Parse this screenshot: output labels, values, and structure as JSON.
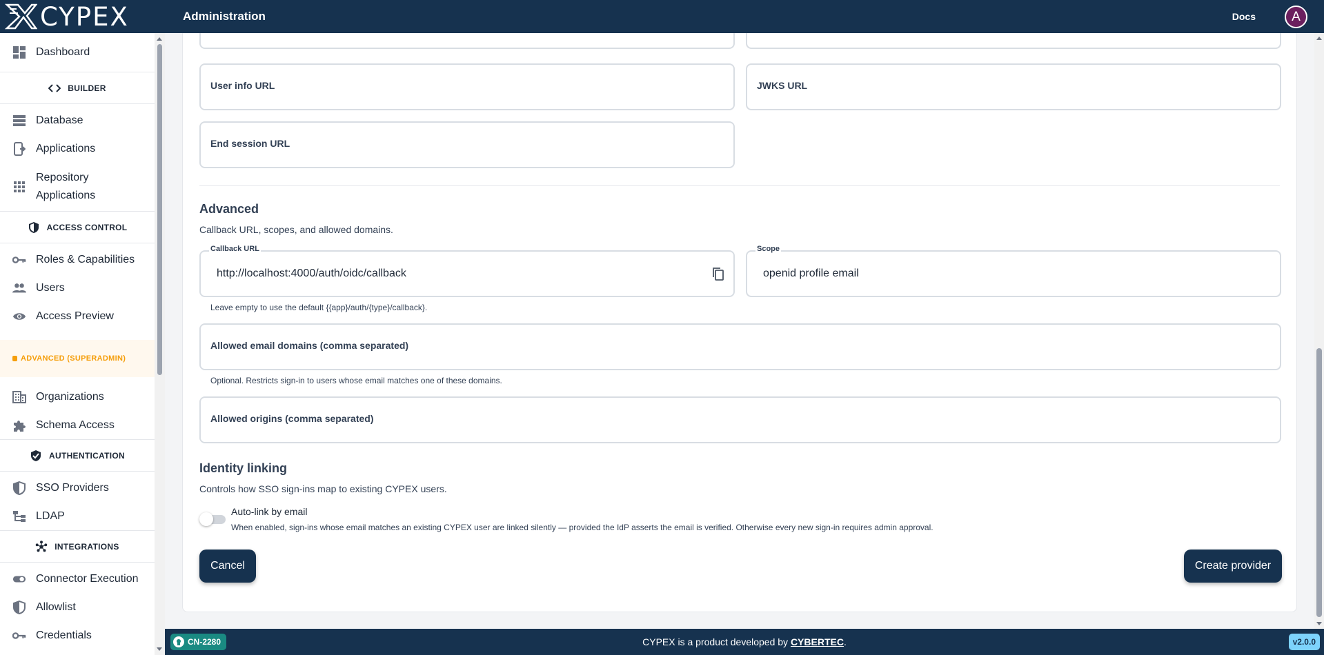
{
  "topbar": {
    "logo_text": "CYPEX",
    "title": "Administration",
    "docs_label": "Docs",
    "avatar_letter": "A"
  },
  "sidebar": {
    "dashboard": "Dashboard",
    "builder_section": "BUILDER",
    "database": "Database",
    "applications": "Applications",
    "repository_line1": "Repository",
    "repository_line2": "Applications",
    "access_control_section": "ACCESS CONTROL",
    "roles": "Roles & Capabilities",
    "users": "Users",
    "access_preview": "Access Preview",
    "advanced_section": "ADVANCED (SUPERADMIN)",
    "organizations": "Organizations",
    "schema_access": "Schema Access",
    "authentication_section": "AUTHENTICATION",
    "sso_providers": "SSO Providers",
    "ldap": "LDAP",
    "integrations_section": "INTEGRATIONS",
    "connector_execution": "Connector Execution",
    "allowlist": "Allowlist",
    "credentials": "Credentials"
  },
  "form": {
    "user_info_url_label": "User info URL",
    "jwks_url_label": "JWKS URL",
    "end_session_url_label": "End session URL",
    "advanced_title": "Advanced",
    "advanced_subtitle": "Callback URL, scopes, and allowed domains.",
    "callback_url_label": "Callback URL",
    "callback_url_value": "http://localhost:4000/auth/oidc/callback",
    "callback_url_helper": "Leave empty to use the default {{app}/auth/{type}/callback}.",
    "scope_label": "Scope",
    "scope_value": "openid profile email",
    "allowed_email_domains_label": "Allowed email domains (comma separated)",
    "allowed_email_domains_helper": "Optional. Restricts sign-in to users whose email matches one of these domains.",
    "allowed_origins_label": "Allowed origins (comma separated)",
    "identity_title": "Identity linking",
    "identity_subtitle": "Controls how SSO sign-ins map to existing CYPEX users.",
    "autolink_label": "Auto-link by email",
    "autolink_enabled": false,
    "autolink_helper": "When enabled, sign-ins whose email matches an existing CYPEX user are linked silently — provided the IdP asserts the email is verified. Otherwise every new sign-in requires admin approval.",
    "cancel_label": "Cancel",
    "create_label": "Create provider"
  },
  "footer": {
    "branch_badge": "CN-2280",
    "text_prefix": "CYPEX is a product developed by ",
    "company_link": "CYBERTEC",
    "text_suffix": ".",
    "version": "v2.0.0"
  },
  "colors": {
    "primary": "#16324f",
    "warning": "#f59e0b",
    "badge_teal": "#1a8a82",
    "version_badge": "#7dd3fc"
  },
  "icons": {
    "dashboard": "dashboard-icon",
    "builder": "code-icon",
    "database": "database-icon",
    "applications": "app-icon",
    "repository": "grid-icon",
    "access_control": "shield-icon",
    "roles": "key-icon",
    "users": "people-icon",
    "access_preview": "eye-icon",
    "organizations": "building-icon",
    "schema_access": "puzzle-icon",
    "authentication": "shield-check-icon",
    "sso": "shield-half-icon",
    "ldap": "tree-icon",
    "integrations": "hub-icon",
    "connector": "toggle-icon",
    "allowlist": "shield-half-icon",
    "credentials": "key-icon",
    "copy": "copy-icon"
  }
}
